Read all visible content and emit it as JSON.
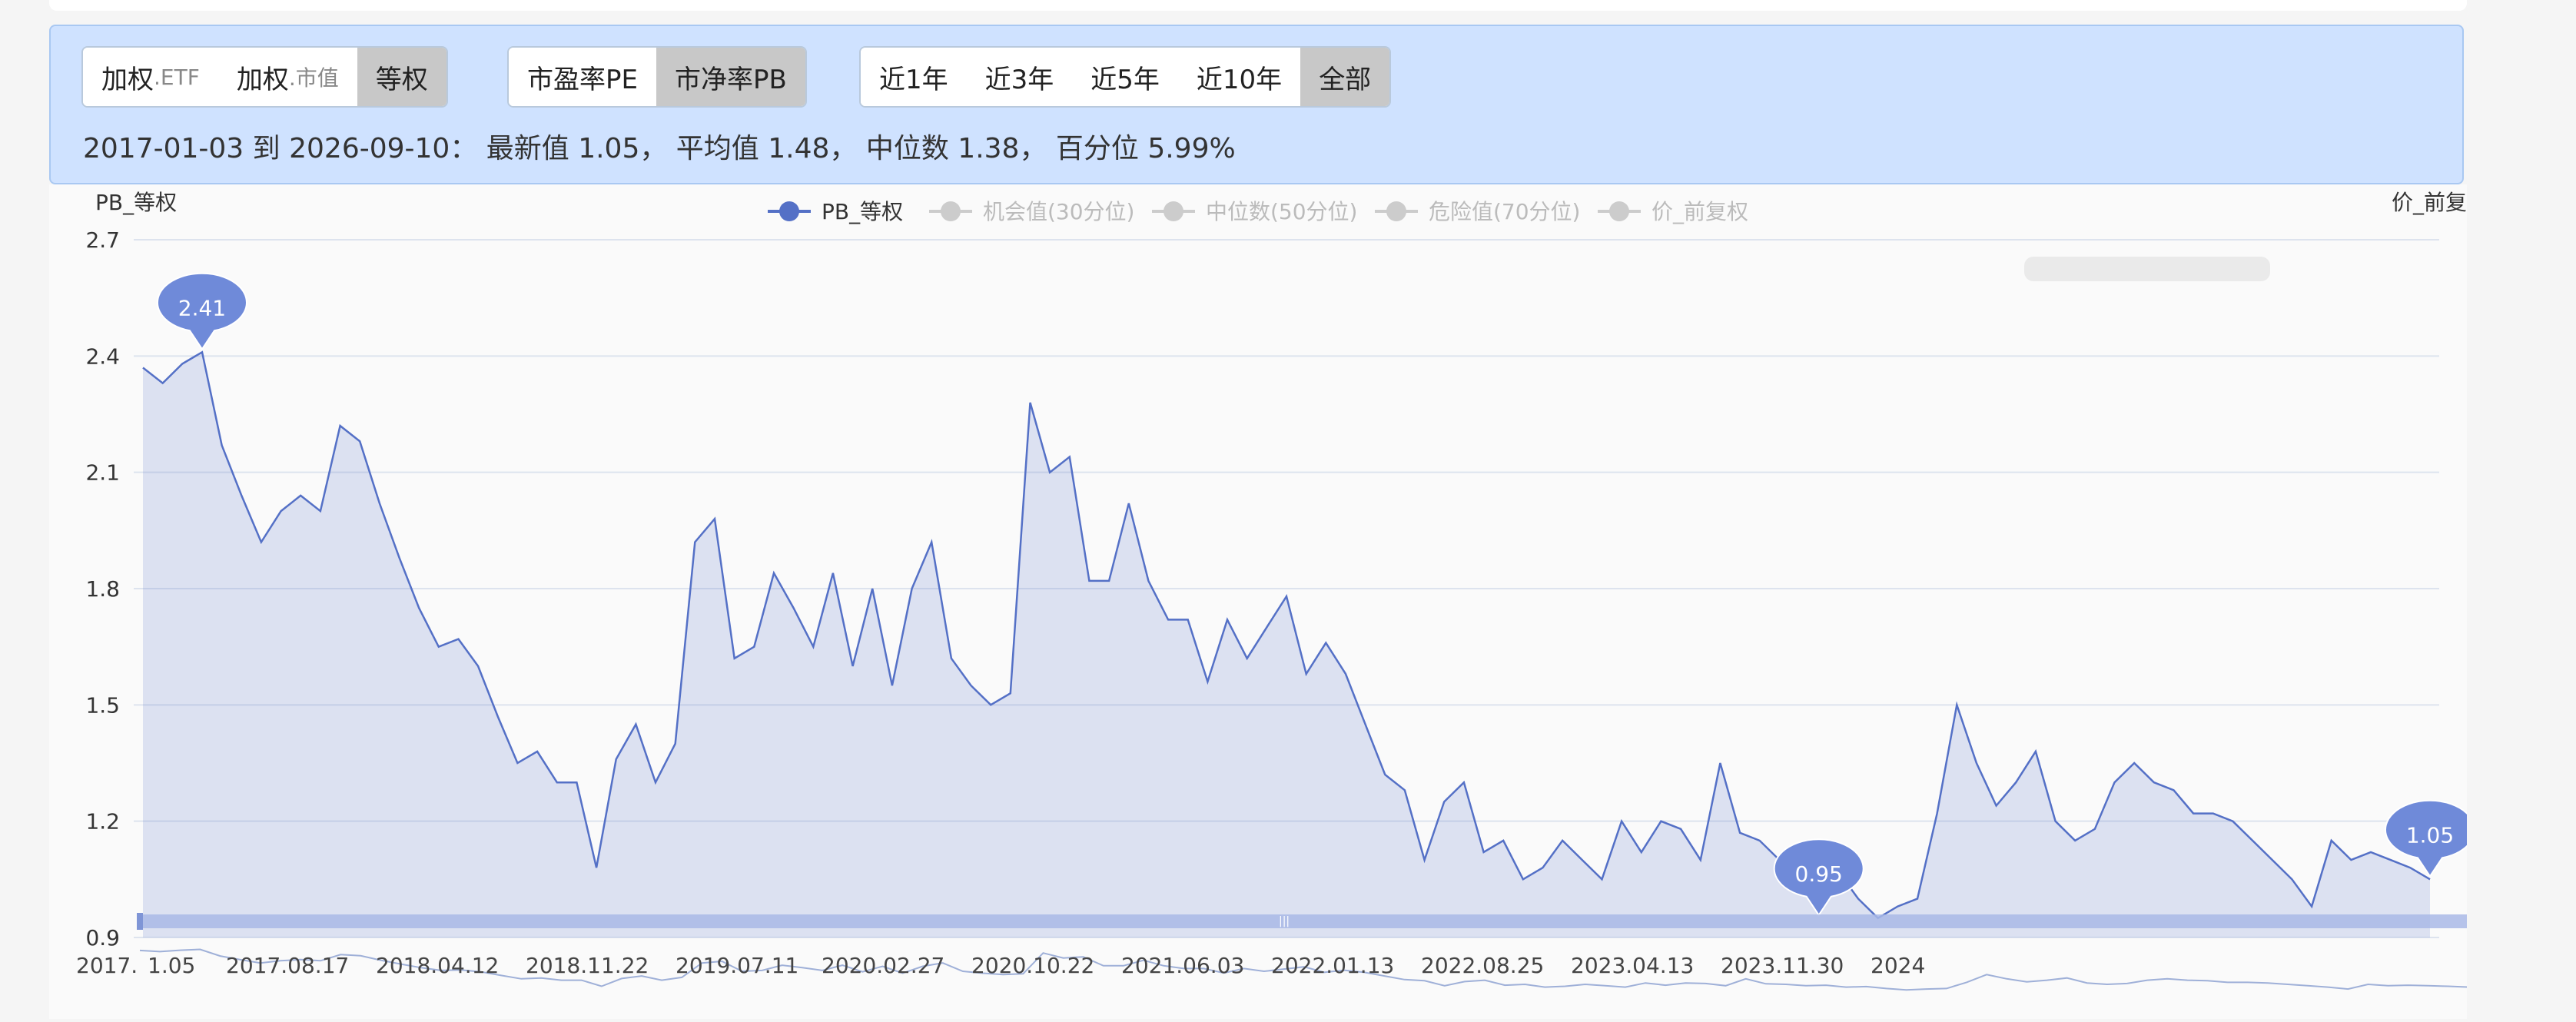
{
  "toolbar": {
    "weight_group": [
      {
        "main": "加权",
        "sub": ".ETF",
        "active": false
      },
      {
        "main": "加权",
        "sub": ".市值",
        "active": false
      },
      {
        "main": "等权",
        "sub": "",
        "active": true
      }
    ],
    "metric_group": [
      {
        "label": "市盈率PE",
        "active": false
      },
      {
        "label": "市净率PB",
        "active": true
      }
    ],
    "range_group": [
      {
        "label": "近1年",
        "active": false
      },
      {
        "label": "近3年",
        "active": false
      },
      {
        "label": "近5年",
        "active": false
      },
      {
        "label": "近10年",
        "active": false
      },
      {
        "label": "全部",
        "active": true
      }
    ]
  },
  "summary": {
    "text": "2017-01-03 到 2026-09-10： 最新值 1.05， 平均值 1.48， 中位数 1.38， 百分位 5.99%"
  },
  "colors": {
    "line": "#5470c6",
    "area": "rgba(84,112,198,0.18)",
    "marker": "#6f8ad9",
    "legend_inactive": "#cccccc",
    "grid": "#dde3ee",
    "slider": "#a9b8e6"
  },
  "chart_data": {
    "type": "area",
    "y_axis_name": "PB_等权",
    "right_axis_name": "价_前复",
    "legend": [
      {
        "name": "PB_等权",
        "active": true
      },
      {
        "name": "机会值(30分位)",
        "active": false
      },
      {
        "name": "中位数(50分位)",
        "active": false
      },
      {
        "name": "危险值(70分位)",
        "active": false
      },
      {
        "name": "价_前复权",
        "active": false
      }
    ],
    "ylim": [
      0.9,
      2.7
    ],
    "y_ticks": [
      "2.7",
      "2.4",
      "2.1",
      "1.8",
      "1.5",
      "1.2",
      "0.9"
    ],
    "x_tick_labels": [
      "2017.01.05",
      "2017.08.17",
      "2018.04.12",
      "2018.11.22",
      "2019.07.11",
      "2020.02.27",
      "2020.10.22",
      "2021.06.03",
      "2022.01.13",
      "2022.08.25",
      "2023.04.13",
      "2023.11.30",
      "2024"
    ],
    "x_tick_display": [
      "2017.",
      "1.05",
      "2017.08.17",
      "2018.04.12",
      "2018.11.22",
      "2019.07.11",
      "2020.02.27",
      "2020.10.22",
      "2021.06.03",
      "2022.01.13",
      "2022.08.25",
      "2023.04.13",
      "2023.11.30",
      "2024"
    ],
    "markers": [
      {
        "label": "2.41",
        "x": "2017.04",
        "y": 2.41
      },
      {
        "label": "0.95",
        "x": "2024.02",
        "y": 0.95
      },
      {
        "label": "1.05",
        "x": "2026.09",
        "y": 1.05
      }
    ],
    "series": [
      {
        "name": "PB_等权",
        "x": [
          "2017.01",
          "2017.02",
          "2017.03",
          "2017.04",
          "2017.05",
          "2017.06",
          "2017.07",
          "2017.08",
          "2017.09",
          "2017.10",
          "2017.11",
          "2017.12",
          "2018.01",
          "2018.02",
          "2018.03",
          "2018.04",
          "2018.05",
          "2018.06",
          "2018.07",
          "2018.08",
          "2018.09",
          "2018.10",
          "2018.11",
          "2018.12",
          "2019.01",
          "2019.02",
          "2019.03",
          "2019.04",
          "2019.05",
          "2019.06",
          "2019.07",
          "2019.08",
          "2019.09",
          "2019.10",
          "2019.11",
          "2019.12",
          "2020.01",
          "2020.02",
          "2020.03",
          "2020.04",
          "2020.05",
          "2020.06",
          "2020.07",
          "2020.08",
          "2020.09",
          "2020.10",
          "2020.11",
          "2020.12",
          "2021.01",
          "2021.02",
          "2021.03",
          "2021.04",
          "2021.05",
          "2021.06",
          "2021.07",
          "2021.08",
          "2021.09",
          "2021.10",
          "2021.11",
          "2021.12",
          "2022.01",
          "2022.02",
          "2022.03",
          "2022.04",
          "2022.05",
          "2022.06",
          "2022.07",
          "2022.08",
          "2022.09",
          "2022.10",
          "2022.11",
          "2022.12",
          "2023.01",
          "2023.02",
          "2023.03",
          "2023.04",
          "2023.05",
          "2023.06",
          "2023.07",
          "2023.08",
          "2023.09",
          "2023.10",
          "2023.11",
          "2023.12",
          "2024.01",
          "2024.02",
          "2024.03",
          "2024.04",
          "2024.05",
          "2024.06",
          "2024.07",
          "2024.08",
          "2024.09",
          "2024.10",
          "2024.11",
          "2024.12",
          "2025.01",
          "2025.02",
          "2025.03",
          "2025.04",
          "2025.05",
          "2025.06",
          "2025.07",
          "2025.08",
          "2025.09",
          "2025.10",
          "2025.11",
          "2025.12",
          "2026.01",
          "2026.02",
          "2026.03",
          "2026.04",
          "2026.05",
          "2026.06",
          "2026.07",
          "2026.08",
          "2026.09"
        ],
        "values": [
          2.37,
          2.33,
          2.38,
          2.41,
          2.17,
          2.04,
          1.92,
          2.0,
          2.04,
          2.0,
          2.22,
          2.18,
          2.02,
          1.88,
          1.75,
          1.65,
          1.67,
          1.6,
          1.47,
          1.35,
          1.38,
          1.3,
          1.3,
          1.08,
          1.36,
          1.45,
          1.3,
          1.4,
          1.92,
          1.98,
          1.62,
          1.65,
          1.84,
          1.75,
          1.65,
          1.84,
          1.6,
          1.8,
          1.55,
          1.8,
          1.92,
          1.62,
          1.55,
          1.5,
          1.53,
          2.28,
          2.1,
          2.14,
          1.82,
          1.82,
          2.02,
          1.82,
          1.72,
          1.72,
          1.56,
          1.72,
          1.62,
          1.7,
          1.78,
          1.58,
          1.66,
          1.58,
          1.45,
          1.32,
          1.28,
          1.1,
          1.25,
          1.3,
          1.12,
          1.15,
          1.05,
          1.08,
          1.15,
          1.1,
          1.05,
          1.2,
          1.12,
          1.2,
          1.18,
          1.1,
          1.35,
          1.17,
          1.15,
          1.1,
          1.12,
          1.05,
          1.07,
          1.0,
          0.95,
          0.98,
          1.0,
          1.22,
          1.5,
          1.35,
          1.24,
          1.3,
          1.38,
          1.2,
          1.15,
          1.18,
          1.3,
          1.35,
          1.3,
          1.28,
          1.22,
          1.22,
          1.2,
          1.15,
          1.1,
          1.05,
          0.98,
          1.15,
          1.1,
          1.12,
          1.1,
          1.08,
          1.05
        ]
      }
    ],
    "grid": true,
    "legend_position": "top-center"
  }
}
